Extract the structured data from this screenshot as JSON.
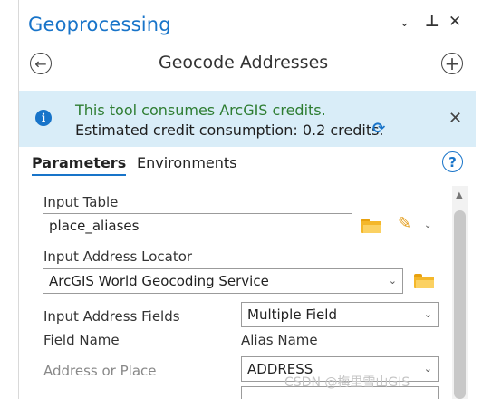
{
  "pane": {
    "title": "Geoprocessing",
    "controls": {
      "dropdown": "⌄",
      "pin": "⊥",
      "close": "✕"
    }
  },
  "nav": {
    "back": "←",
    "tool_name": "Geocode Addresses",
    "add": "+"
  },
  "banner": {
    "line1": "This tool consumes ArcGIS credits.",
    "line2": "Estimated credit consumption: 0.2 credits.",
    "close": "✕",
    "info": "i",
    "refresh": "⟳"
  },
  "tabs": [
    {
      "label": "Parameters",
      "active": true
    },
    {
      "label": "Environments",
      "active": false
    }
  ],
  "help": "?",
  "params": {
    "input_table_label": "Input Table",
    "input_table_value": "place_aliases",
    "locator_label": "Input Address Locator",
    "locator_value": "ArcGIS World Geocoding Service",
    "fields_label": "Input Address Fields",
    "fields_value": "Multiple Field",
    "field_name_header": "Field Name",
    "alias_name_header": "Alias Name",
    "address_label": "Address or Place",
    "address_value": "ADDRESS"
  },
  "watermark": "CSDN @梅里雪山GIS",
  "colors": {
    "accent": "#1874c9",
    "banner_bg": "#d9edf8",
    "success_text": "#2e7d32",
    "folder": "#f4b72a"
  }
}
